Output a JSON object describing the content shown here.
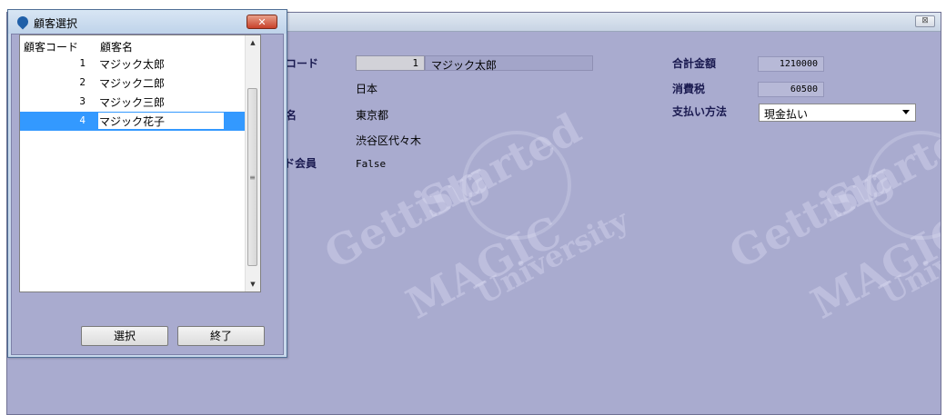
{
  "main_form": {
    "close_glyph": "⊠",
    "watermark": {
      "getting": "Getting",
      "started": "Started",
      "magic": "MAGIC",
      "university": "University"
    },
    "fields": {
      "customer_code_label": "コード",
      "customer_code_value": "1",
      "customer_name_value": "マジック太郎",
      "country_value": "日本",
      "address_label": "名",
      "prefecture_value": "東京都",
      "city_value": "渋谷区代々木",
      "gold_member_label": "レド会員",
      "gold_member_value": "False",
      "total_label": "合計金額",
      "total_value": "1210000",
      "tax_label": "消費税",
      "tax_value": "60500",
      "payment_label": "支払い方法",
      "payment_value": "現金払い"
    }
  },
  "dialog": {
    "title": "顧客選択",
    "close_glyph": "✕",
    "columns": [
      "顧客コード",
      "顧客名"
    ],
    "rows": [
      {
        "code": "1",
        "name": "マジック太郎"
      },
      {
        "code": "2",
        "name": "マジック二郎"
      },
      {
        "code": "3",
        "name": "マジック三郎"
      },
      {
        "code": "4",
        "name": "マジック花子"
      }
    ],
    "selected_index": 3,
    "scroll_thumb_glyph": "≡",
    "scroll_up_glyph": "▲",
    "scroll_down_glyph": "▼",
    "buttons": {
      "select": "選択",
      "exit": "終了"
    }
  },
  "colors": {
    "form_background": "#a9abcf",
    "selection": "#3399ff",
    "dialog_close": "#c8412a"
  }
}
